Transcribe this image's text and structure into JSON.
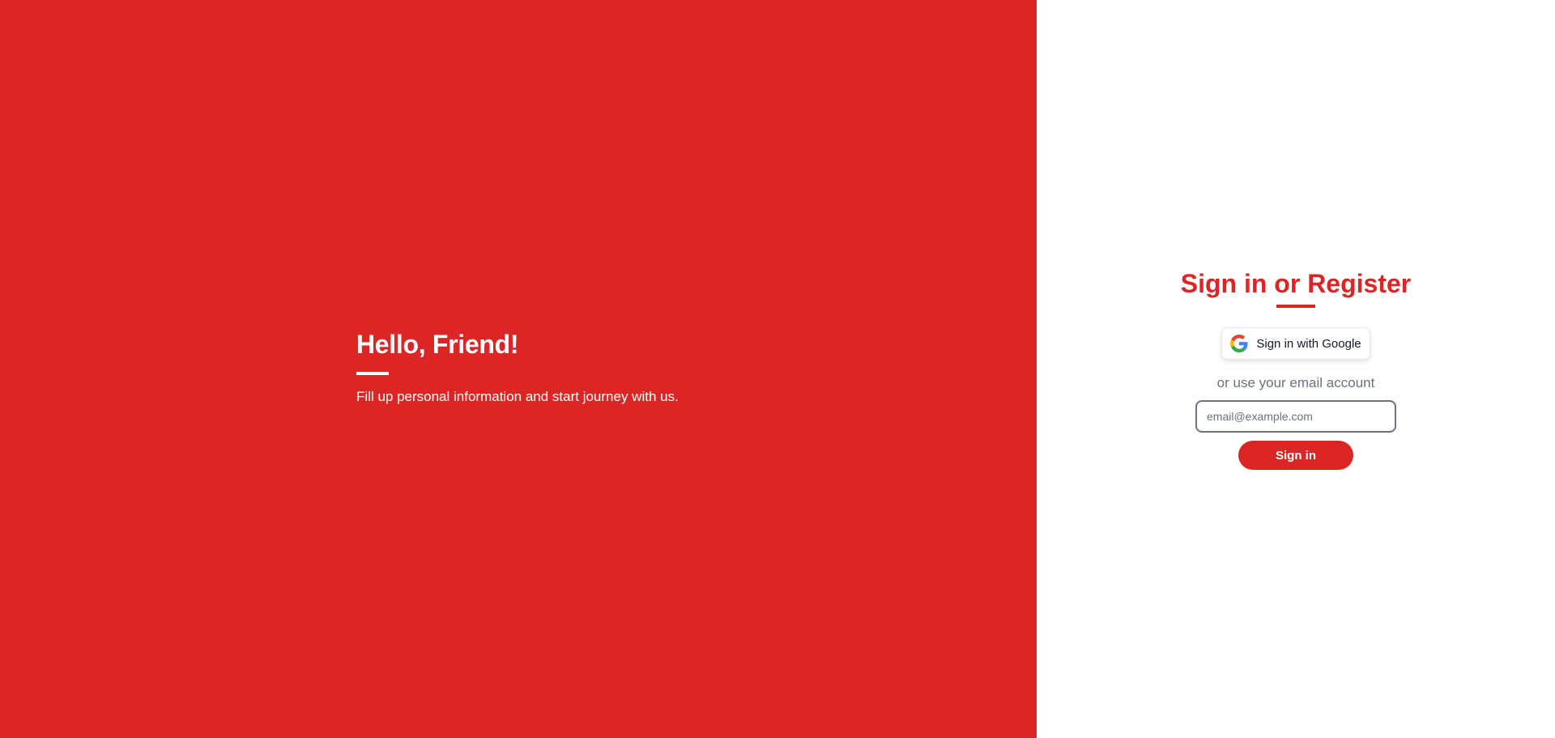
{
  "colors": {
    "brand": "#dc2626",
    "panel_background": "#ffffff",
    "muted_text": "#6b7280"
  },
  "welcome": {
    "title": "Hello, Friend!",
    "subtitle": "Fill up personal information and start journey with us."
  },
  "auth": {
    "title": "Sign in or Register",
    "google_button": {
      "icon": "google-icon",
      "label": "Sign in with Google"
    },
    "divider_text": "or use your email account",
    "email": {
      "placeholder": "email@example.com",
      "value": ""
    },
    "submit_label": "Sign in"
  }
}
